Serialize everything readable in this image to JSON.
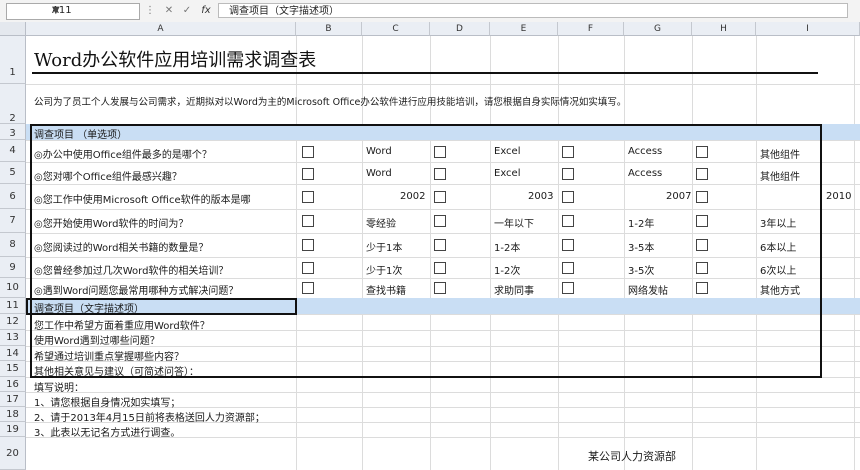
{
  "formula_bar": {
    "name_box": "A11",
    "formula": "调查项目（文字描述项）"
  },
  "columns": [
    "A",
    "B",
    "C",
    "D",
    "E",
    "F",
    "G",
    "H",
    "I"
  ],
  "rows": [
    "1",
    "2",
    "3",
    "4",
    "5",
    "6",
    "7",
    "8",
    "9",
    "10",
    "11",
    "12",
    "13",
    "14",
    "15",
    "16",
    "17",
    "18",
    "19",
    "20"
  ],
  "sheet": {
    "title": "Word办公软件应用培训需求调查表",
    "intro": "公司为了员工个人发展与公司需求，近期拟对以Word为主的Microsoft Office办公软件进行应用技能培训，请您根据自身实际情况如实填写。",
    "section1": "调查项目 （单选项）",
    "questions": [
      {
        "q": "◎办公中使用Office组件最多的是哪个？",
        "opts": [
          "Word",
          "Excel",
          "Access",
          "其他组件"
        ]
      },
      {
        "q": "◎您对哪个Office组件最感兴趣？",
        "opts": [
          "Word",
          "Excel",
          "Access",
          "其他组件"
        ]
      },
      {
        "q": "◎您工作中使用Microsoft Office软件的版本是哪",
        "opts": [
          "2002",
          "2003",
          "2007",
          "2010"
        ]
      },
      {
        "q": "◎您开始使用Word软件的时间为？",
        "opts": [
          "零经验",
          "一年以下",
          "1-2年",
          "3年以上"
        ]
      },
      {
        "q": "◎您阅读过的Word相关书籍的数量是？",
        "opts": [
          "少于1本",
          "1-2本",
          "3-5本",
          "6本以上"
        ]
      },
      {
        "q": "◎您曾经参加过几次Word软件的相关培训？",
        "opts": [
          "少于1次",
          "1-2次",
          "3-5次",
          "6次以上"
        ]
      },
      {
        "q": "◎遇到Word问题您最常用哪种方式解决问题？",
        "opts": [
          "查找书籍",
          "求助同事",
          "网络发帖",
          "其他方式"
        ]
      }
    ],
    "section2": "调查项目（文字描述项）",
    "text_items": [
      "您工作中希望方面着重应用Word软件？",
      "使用Word遇到过哪些问题？",
      "希望通过培训重点掌握哪些内容？",
      "其他相关意见与建议（可简述问答）："
    ],
    "notes_title": "填写说明：",
    "notes": [
      "1、请您根据自身情况如实填写；",
      "2、请于2013年4月15日前将表格送回人力资源部；",
      "3、此表以无记名方式进行调查。"
    ],
    "footer": "某公司人力资源部"
  }
}
